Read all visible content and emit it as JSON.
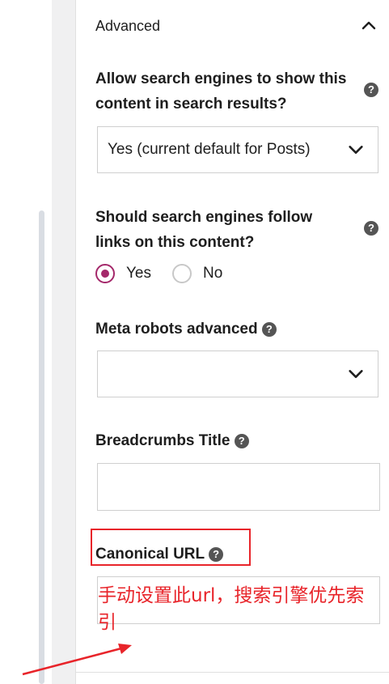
{
  "section": {
    "title": "Advanced"
  },
  "fields": {
    "search_visibility": {
      "label_line1": "Allow search engines to show this",
      "label_line2": "content in search results?",
      "value": "Yes (current default for Posts)"
    },
    "follow_links": {
      "label_line1": "Should search engines follow",
      "label_line2": "links on this content?",
      "options": [
        "Yes",
        "No"
      ],
      "selected": "Yes"
    },
    "meta_robots": {
      "label": "Meta robots advanced",
      "value": ""
    },
    "breadcrumbs_title": {
      "label": "Breadcrumbs Title",
      "value": ""
    },
    "canonical_url": {
      "label": "Canonical URL",
      "value": ""
    }
  },
  "help_glyph": "?",
  "annotation": {
    "text": "手动设置此url，搜索引擎优先索引",
    "color": "#e8242a"
  },
  "colors": {
    "accent": "#a4286a",
    "annotation_red": "#e8242a"
  },
  "icons": [
    "chevron-up-icon",
    "chevron-down-icon",
    "help-icon"
  ]
}
